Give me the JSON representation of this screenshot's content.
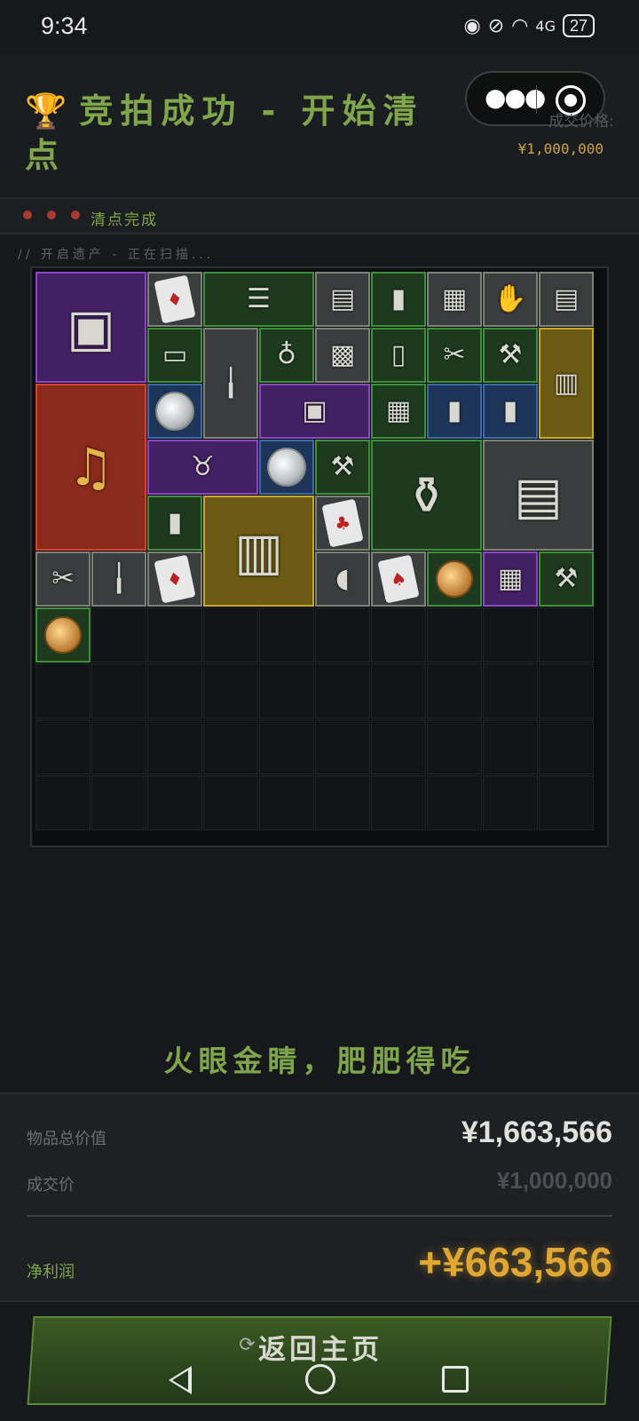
{
  "status_bar": {
    "time": "9:34",
    "battery": "27",
    "network": "4G"
  },
  "header": {
    "title": "竞拍成功 - 开始清点",
    "trophy_icon": "trophy-icon",
    "price_label": "成交价格:",
    "price_value": "¥1,000,000"
  },
  "status_strip": {
    "text": "清点完成"
  },
  "scan_text": "// 开启遗产 - 正在扫描...",
  "grid": {
    "columns": 10,
    "rows": 10,
    "items": [
      {
        "name": "thermal-cycler",
        "icon": "machine-icon",
        "glyph": "▣",
        "rarity": "purple",
        "col": 0,
        "row": 0,
        "w": 2,
        "h": 2
      },
      {
        "name": "playing-card",
        "icon": "card-icon",
        "glyph": "♦",
        "rarity": "gray",
        "col": 2,
        "row": 0,
        "w": 1,
        "h": 1
      },
      {
        "name": "old-documents",
        "icon": "document-icon",
        "glyph": "☰",
        "rarity": "green",
        "col": 3,
        "row": 0,
        "w": 2,
        "h": 1
      },
      {
        "name": "device",
        "icon": "device-icon",
        "glyph": "▤",
        "rarity": "gray",
        "col": 5,
        "row": 0,
        "w": 1,
        "h": 1
      },
      {
        "name": "lighter",
        "icon": "lighter-icon",
        "glyph": "▮",
        "rarity": "green",
        "col": 6,
        "row": 0,
        "w": 1,
        "h": 1
      },
      {
        "name": "toolbox",
        "icon": "box-icon",
        "glyph": "▦",
        "rarity": "gray",
        "col": 7,
        "row": 0,
        "w": 1,
        "h": 1
      },
      {
        "name": "glove",
        "icon": "glove-icon",
        "glyph": "✋",
        "rarity": "gray",
        "col": 8,
        "row": 0,
        "w": 1,
        "h": 1
      },
      {
        "name": "device-2",
        "icon": "device-icon",
        "glyph": "▤",
        "rarity": "gray",
        "col": 9,
        "row": 0,
        "w": 1,
        "h": 1
      },
      {
        "name": "battery-pack",
        "icon": "battery-icon",
        "glyph": "▭",
        "rarity": "green",
        "col": 2,
        "row": 1,
        "w": 1,
        "h": 1
      },
      {
        "name": "soldering-iron",
        "icon": "tool-icon",
        "glyph": "╽",
        "rarity": "gray",
        "col": 3,
        "row": 1,
        "w": 1,
        "h": 2
      },
      {
        "name": "pendant",
        "icon": "pendant-icon",
        "glyph": "♁",
        "rarity": "green",
        "col": 4,
        "row": 1,
        "w": 1,
        "h": 1
      },
      {
        "name": "cloth",
        "icon": "cloth-icon",
        "glyph": "▩",
        "rarity": "gray",
        "col": 5,
        "row": 1,
        "w": 1,
        "h": 1
      },
      {
        "name": "bottle",
        "icon": "bottle-icon",
        "glyph": "▯",
        "rarity": "green",
        "col": 6,
        "row": 1,
        "w": 1,
        "h": 1
      },
      {
        "name": "forceps",
        "icon": "scissors-icon",
        "glyph": "✂",
        "rarity": "green",
        "col": 7,
        "row": 1,
        "w": 1,
        "h": 1
      },
      {
        "name": "pliers",
        "icon": "pliers-icon",
        "glyph": "⚒",
        "rarity": "green",
        "col": 8,
        "row": 1,
        "w": 1,
        "h": 1
      },
      {
        "name": "map-note",
        "icon": "note-icon",
        "glyph": "▥",
        "rarity": "yellow",
        "col": 9,
        "row": 1,
        "w": 1,
        "h": 2
      },
      {
        "name": "gramophone",
        "icon": "gramophone-icon",
        "glyph": "♫",
        "rarity": "red",
        "col": 0,
        "row": 2,
        "w": 2,
        "h": 3
      },
      {
        "name": "silver-coin",
        "icon": "coin-icon",
        "glyph": "silver",
        "rarity": "blue",
        "col": 2,
        "row": 2,
        "w": 1,
        "h": 1
      },
      {
        "name": "electronics-pack",
        "icon": "package-icon",
        "glyph": "▣",
        "rarity": "purple",
        "col": 4,
        "row": 2,
        "w": 2,
        "h": 1
      },
      {
        "name": "circuit-board",
        "icon": "chip-icon",
        "glyph": "▦",
        "rarity": "green",
        "col": 6,
        "row": 2,
        "w": 1,
        "h": 1
      },
      {
        "name": "pill-tube",
        "icon": "tube-icon",
        "glyph": "▮",
        "rarity": "blue",
        "col": 7,
        "row": 2,
        "w": 1,
        "h": 1
      },
      {
        "name": "pill-tube-2",
        "icon": "tube-icon",
        "glyph": "▮",
        "rarity": "blue",
        "col": 8,
        "row": 2,
        "w": 1,
        "h": 1
      },
      {
        "name": "horns",
        "icon": "horns-icon",
        "glyph": "♉",
        "rarity": "purple",
        "col": 2,
        "row": 3,
        "w": 2,
        "h": 1
      },
      {
        "name": "silver-coin-2",
        "icon": "coin-icon",
        "glyph": "silver",
        "rarity": "blue",
        "col": 4,
        "row": 3,
        "w": 1,
        "h": 1
      },
      {
        "name": "pliers-2",
        "icon": "pliers-icon",
        "glyph": "⚒",
        "rarity": "green",
        "col": 5,
        "row": 3,
        "w": 1,
        "h": 1
      },
      {
        "name": "spice-rack",
        "icon": "rack-icon",
        "glyph": "⚱",
        "rarity": "green",
        "col": 6,
        "row": 3,
        "w": 2,
        "h": 2
      },
      {
        "name": "candle-box",
        "icon": "box-icon",
        "glyph": "▤",
        "rarity": "gray",
        "col": 8,
        "row": 3,
        "w": 2,
        "h": 2
      },
      {
        "name": "phone-battery",
        "icon": "battery-icon",
        "glyph": "▮",
        "rarity": "green",
        "col": 2,
        "row": 4,
        "w": 1,
        "h": 1
      },
      {
        "name": "id-badge",
        "icon": "badge-icon",
        "glyph": "▥",
        "rarity": "yellow",
        "col": 3,
        "row": 4,
        "w": 2,
        "h": 2
      },
      {
        "name": "playing-card-2",
        "icon": "card-icon",
        "glyph": "♣",
        "rarity": "gray",
        "col": 5,
        "row": 4,
        "w": 1,
        "h": 1
      },
      {
        "name": "scissors",
        "icon": "scissors-icon",
        "glyph": "✂",
        "rarity": "gray",
        "col": 0,
        "row": 5,
        "w": 1,
        "h": 1
      },
      {
        "name": "spark-plug",
        "icon": "plug-icon",
        "glyph": "╽",
        "rarity": "gray",
        "col": 1,
        "row": 5,
        "w": 1,
        "h": 1
      },
      {
        "name": "playing-card-3",
        "icon": "card-icon",
        "glyph": "♦",
        "rarity": "gray",
        "col": 2,
        "row": 5,
        "w": 1,
        "h": 1
      },
      {
        "name": "mouse",
        "icon": "mouse-icon",
        "glyph": "◖",
        "rarity": "gray",
        "col": 5,
        "row": 5,
        "w": 1,
        "h": 1
      },
      {
        "name": "portrait-card",
        "icon": "card-icon",
        "glyph": "♠",
        "rarity": "gray",
        "col": 6,
        "row": 5,
        "w": 1,
        "h": 1
      },
      {
        "name": "gold-coin",
        "icon": "coin-icon",
        "glyph": "gold",
        "rarity": "green",
        "col": 7,
        "row": 5,
        "w": 1,
        "h": 1
      },
      {
        "name": "chip-board",
        "icon": "chip-icon",
        "glyph": "▦",
        "rarity": "purple",
        "col": 8,
        "row": 5,
        "w": 1,
        "h": 1
      },
      {
        "name": "pliers-3",
        "icon": "pliers-icon",
        "glyph": "⚒",
        "rarity": "green",
        "col": 9,
        "row": 5,
        "w": 1,
        "h": 1
      },
      {
        "name": "gold-coin-2",
        "icon": "coin-icon",
        "glyph": "gold",
        "rarity": "green",
        "col": 0,
        "row": 6,
        "w": 1,
        "h": 1
      }
    ]
  },
  "slogan": "火眼金睛，肥肥得吃",
  "summary": {
    "total_label": "物品总价值",
    "total_value": "¥1,663,566",
    "deal_label": "成交价",
    "deal_value": "¥1,000,000",
    "profit_label": "净利润",
    "profit_value": "+¥663,566"
  },
  "home_button": {
    "label": "返回主页"
  },
  "colors": {
    "accent_green": "#7fa64a",
    "profit_gold": "#e0a832",
    "background": "#16181b"
  }
}
